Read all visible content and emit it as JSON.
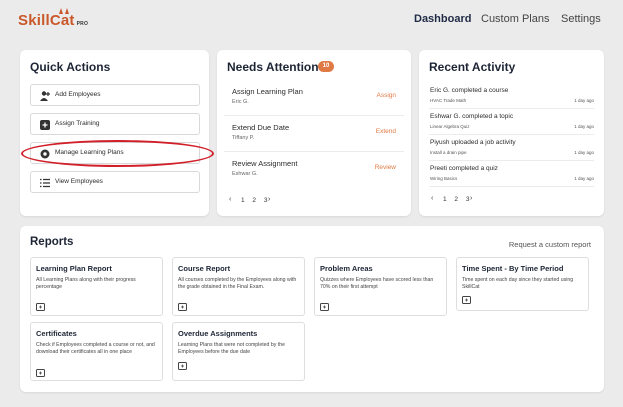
{
  "brand": {
    "name": "SkillCat",
    "tier": "PRO",
    "color": "#c9592b"
  },
  "nav": {
    "dashboard": "Dashboard",
    "custom_plans": "Custom Plans",
    "settings": "Settings"
  },
  "quick_actions": {
    "title": "Quick Actions",
    "items": [
      {
        "label": "Add Employees",
        "icon": "add-user-icon"
      },
      {
        "label": "Assign Training",
        "icon": "plus-square-icon"
      },
      {
        "label": "Manage Learning Plans",
        "icon": "settings-icon"
      },
      {
        "label": "View Employees",
        "icon": "list-icon"
      }
    ]
  },
  "needs_attention": {
    "title": "Needs Attention",
    "count": "10",
    "items": [
      {
        "title": "Assign Learning Plan",
        "person": "Eric G.",
        "action": "Assign"
      },
      {
        "title": "Extend Due Date",
        "person": "Tiffany P.",
        "action": "Extend"
      },
      {
        "title": "Review Assignment",
        "person": "Eshwar G.",
        "action": "Review"
      }
    ],
    "pager": "1 2 3"
  },
  "recent_activity": {
    "title": "Recent Activity",
    "items": [
      {
        "text": "Eric G. completed a course",
        "detail": "HVAC Trade Math",
        "when": "1 day ago"
      },
      {
        "text": "Eshwar G. completed a topic",
        "detail": "Linear Algebra Quiz",
        "when": "1 day ago"
      },
      {
        "text": "Piyush uploaded a job activity",
        "detail": "Install a drain pipe",
        "when": "1 day ago"
      },
      {
        "text": "Preeti completed a quiz",
        "detail": "Wiring Basics",
        "when": "1 day ago"
      }
    ],
    "pager": "1 2 3"
  },
  "reports": {
    "title": "Reports",
    "request_link": "Request a custom report",
    "items": [
      {
        "title": "Learning Plan Report",
        "desc": "All Learning Plans along with their progress percentage"
      },
      {
        "title": "Course Report",
        "desc": "All courses completed by the Employees along with the grade obtained in the Final Exam."
      },
      {
        "title": "Problem Areas",
        "desc": "Quizzes where Employees have scored less than 70% on their first attempt"
      },
      {
        "title": "Time Spent - By Time Period",
        "desc": "Time spent on each day since they started using SkillCat"
      },
      {
        "title": "Certificates",
        "desc": "Check if Employees completed a course or not, and download their certificates all in one place"
      },
      {
        "title": "Overdue Assignments",
        "desc": "Learning Plans that were not completed by the Employees before the due date"
      }
    ]
  },
  "colors": {
    "accent": "#e07a45",
    "highlight": "#d1202a",
    "text": "#1d2535"
  }
}
